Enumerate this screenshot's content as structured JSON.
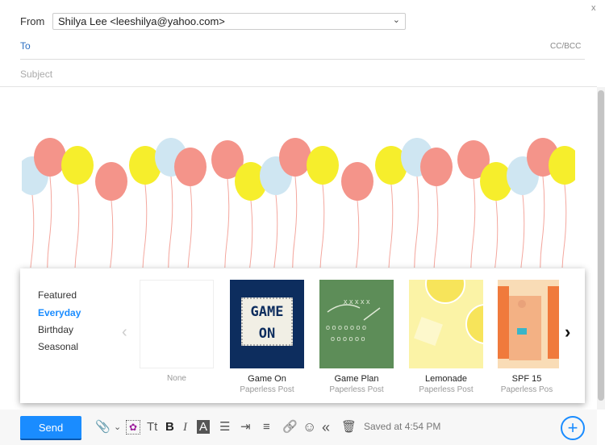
{
  "header": {
    "close": "x",
    "from_label": "From",
    "from_value": "Shilya Lee <leeshilya@yahoo.com>",
    "to_label": "To",
    "ccbcc": "CC/BCC",
    "subject_placeholder": "Subject"
  },
  "stationery": {
    "categories": [
      {
        "label": "Featured",
        "active": false
      },
      {
        "label": "Everyday",
        "active": true
      },
      {
        "label": "Birthday",
        "active": false
      },
      {
        "label": "Seasonal",
        "active": false
      }
    ],
    "templates": [
      {
        "name": "None",
        "source": ""
      },
      {
        "name": "Game On",
        "source": "Paperless Post",
        "art_text": "GAME ON"
      },
      {
        "name": "Game Plan",
        "source": "Paperless Post"
      },
      {
        "name": "Lemonade",
        "source": "Paperless Post"
      },
      {
        "name": "SPF 15",
        "source": "Paperless Pos"
      }
    ],
    "prev": "‹",
    "next": "›"
  },
  "colors": {
    "balloon_red": "#f4948a",
    "balloon_yellow": "#f6ee2c",
    "balloon_blue": "#cfe6f2",
    "accent": "#1a8cff"
  },
  "footer": {
    "send": "Send",
    "saved": "Saved at 4:54 PM",
    "toolbar": {
      "attach": "📎",
      "attach_menu": "⌄",
      "stationery": "✿",
      "font_size": "Tt",
      "bold": "B",
      "italic": "I",
      "color": "A",
      "bullets": "☰",
      "indent": "⇥",
      "align": "≡",
      "link": "🔗",
      "emoji": "☺",
      "quote": "«",
      "delete": "🗑"
    },
    "compose": "+"
  }
}
